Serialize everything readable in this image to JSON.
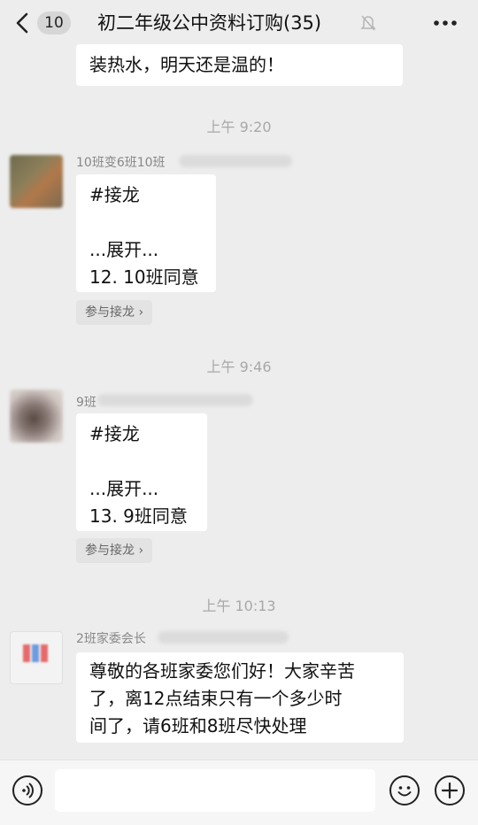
{
  "header": {
    "back_badge": "10",
    "title": "初二年级公中资料订购(35)",
    "back_icon": "chevron-left-icon",
    "mute_icon": "bell-off-icon",
    "more_icon": "more-horizontal-icon"
  },
  "messages": {
    "m0": {
      "lines": [
        "装热水，明天还是温的！"
      ]
    },
    "t1": "上午 9:20",
    "m1": {
      "sender": "10班变6班10班",
      "lines": [
        "#接龙",
        "",
        "...展开...",
        "12. 10班同意"
      ],
      "join_label": "参与接龙 ›"
    },
    "t2": "上午 9:46",
    "m2": {
      "sender": "9班",
      "lines": [
        "#接龙",
        "",
        "...展开...",
        "13. 9班同意"
      ],
      "join_label": "参与接龙 ›"
    },
    "t3": "上午 10:13",
    "m3": {
      "sender": "2班家委会长",
      "lines": [
        "尊敬的各班家委您们好！大家辛苦",
        "了，离12点结束只有一个多少时",
        "间了，请6班和8班尽快处理"
      ]
    }
  },
  "input_bar": {
    "voice_icon": "voice-icon",
    "emoji_icon": "emoji-icon",
    "plus_icon": "plus-icon",
    "text_value": ""
  },
  "colors": {
    "background": "#ededed",
    "bubble": "#ffffff",
    "timestamp": "#a8a8a8",
    "nickname": "#888888"
  }
}
